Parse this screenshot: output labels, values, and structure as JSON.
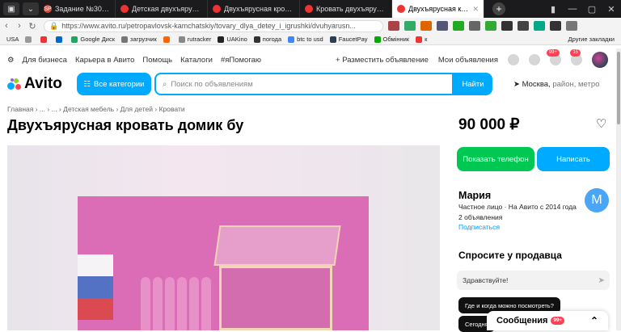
{
  "browser": {
    "tabs": [
      {
        "title": "Задание №3002844 - про",
        "fav_color": "#d94b3b",
        "fav_glyph": "SP",
        "active": false
      },
      {
        "title": "Детская двухъярусная кр",
        "fav_color": "#e33",
        "fav_glyph": "",
        "active": false
      },
      {
        "title": "Двухъярусная кровать с т",
        "fav_color": "#e33",
        "fav_glyph": "",
        "active": false
      },
      {
        "title": "Кровать двухъярусная из",
        "fav_color": "#e33",
        "fav_glyph": "",
        "active": false
      },
      {
        "title": "Двухъярусная кровать д",
        "fav_color": "#e33",
        "fav_glyph": "",
        "active": true
      }
    ],
    "new_tab": "+",
    "url": "https://www.avito.ru/petropavlovsk-kamchatskiy/tovary_dlya_detey_i_igrushki/dvuhyarusn...",
    "bookmarks": [
      {
        "label": "USA",
        "color": "#fff"
      },
      {
        "label": "",
        "color": "#999"
      },
      {
        "label": "",
        "color": "#e33"
      },
      {
        "label": "",
        "color": "#06c"
      },
      {
        "label": "Google Диск",
        "color": "#1fa463"
      },
      {
        "label": "загрузчик",
        "color": "#777"
      },
      {
        "label": "",
        "color": "#f60"
      },
      {
        "label": "rutracker",
        "color": "#888"
      },
      {
        "label": "UAKino",
        "color": "#222"
      },
      {
        "label": "погода",
        "color": "#333"
      },
      {
        "label": "btc to usd",
        "color": "#4285f4"
      },
      {
        "label": "FaucetPay",
        "color": "#2c3e50"
      },
      {
        "label": "Обмінник",
        "color": "#0a0"
      },
      {
        "label": "к",
        "color": "#e33"
      }
    ],
    "other_bookmarks": "Другие закладки"
  },
  "header": {
    "links": [
      "Для бизнеса",
      "Карьера в Авито",
      "Помощь",
      "Каталоги",
      "#яПомогаю"
    ],
    "post_ad": "+ Разместить объявление",
    "my_ads": "Мои объявления",
    "msg_badge": "99+",
    "cart_badge": "15"
  },
  "search": {
    "logo": "Avito",
    "categories": "Все категории",
    "placeholder": "Поиск по объявлениям",
    "find": "Найти",
    "location_city": "Москва,",
    "location_rest": " район, метро"
  },
  "listing": {
    "breadcrumbs": "Главная › ... › ... › Детская мебель › Для детей › Кровати",
    "title": "Двухъярусная кровать домик бу",
    "price": "90 000 ₽",
    "show_phone": "Показать телефон",
    "write": "Написать"
  },
  "seller": {
    "name": "Мария",
    "line1": "Частное лицо · На Авито с 2014 года",
    "line2": "2 объявления",
    "subscribe": "Подписаться",
    "initial": "M"
  },
  "ask": {
    "heading": "Спросите у продавца",
    "message": "Здравствуйте!",
    "chips": [
      "Где и когда можно посмотреть?",
      "Сегодня"
    ]
  },
  "messenger": {
    "label": "Сообщения",
    "badge": "99+"
  },
  "colors": {
    "accent": "#00aaff",
    "green": "#00c853"
  }
}
